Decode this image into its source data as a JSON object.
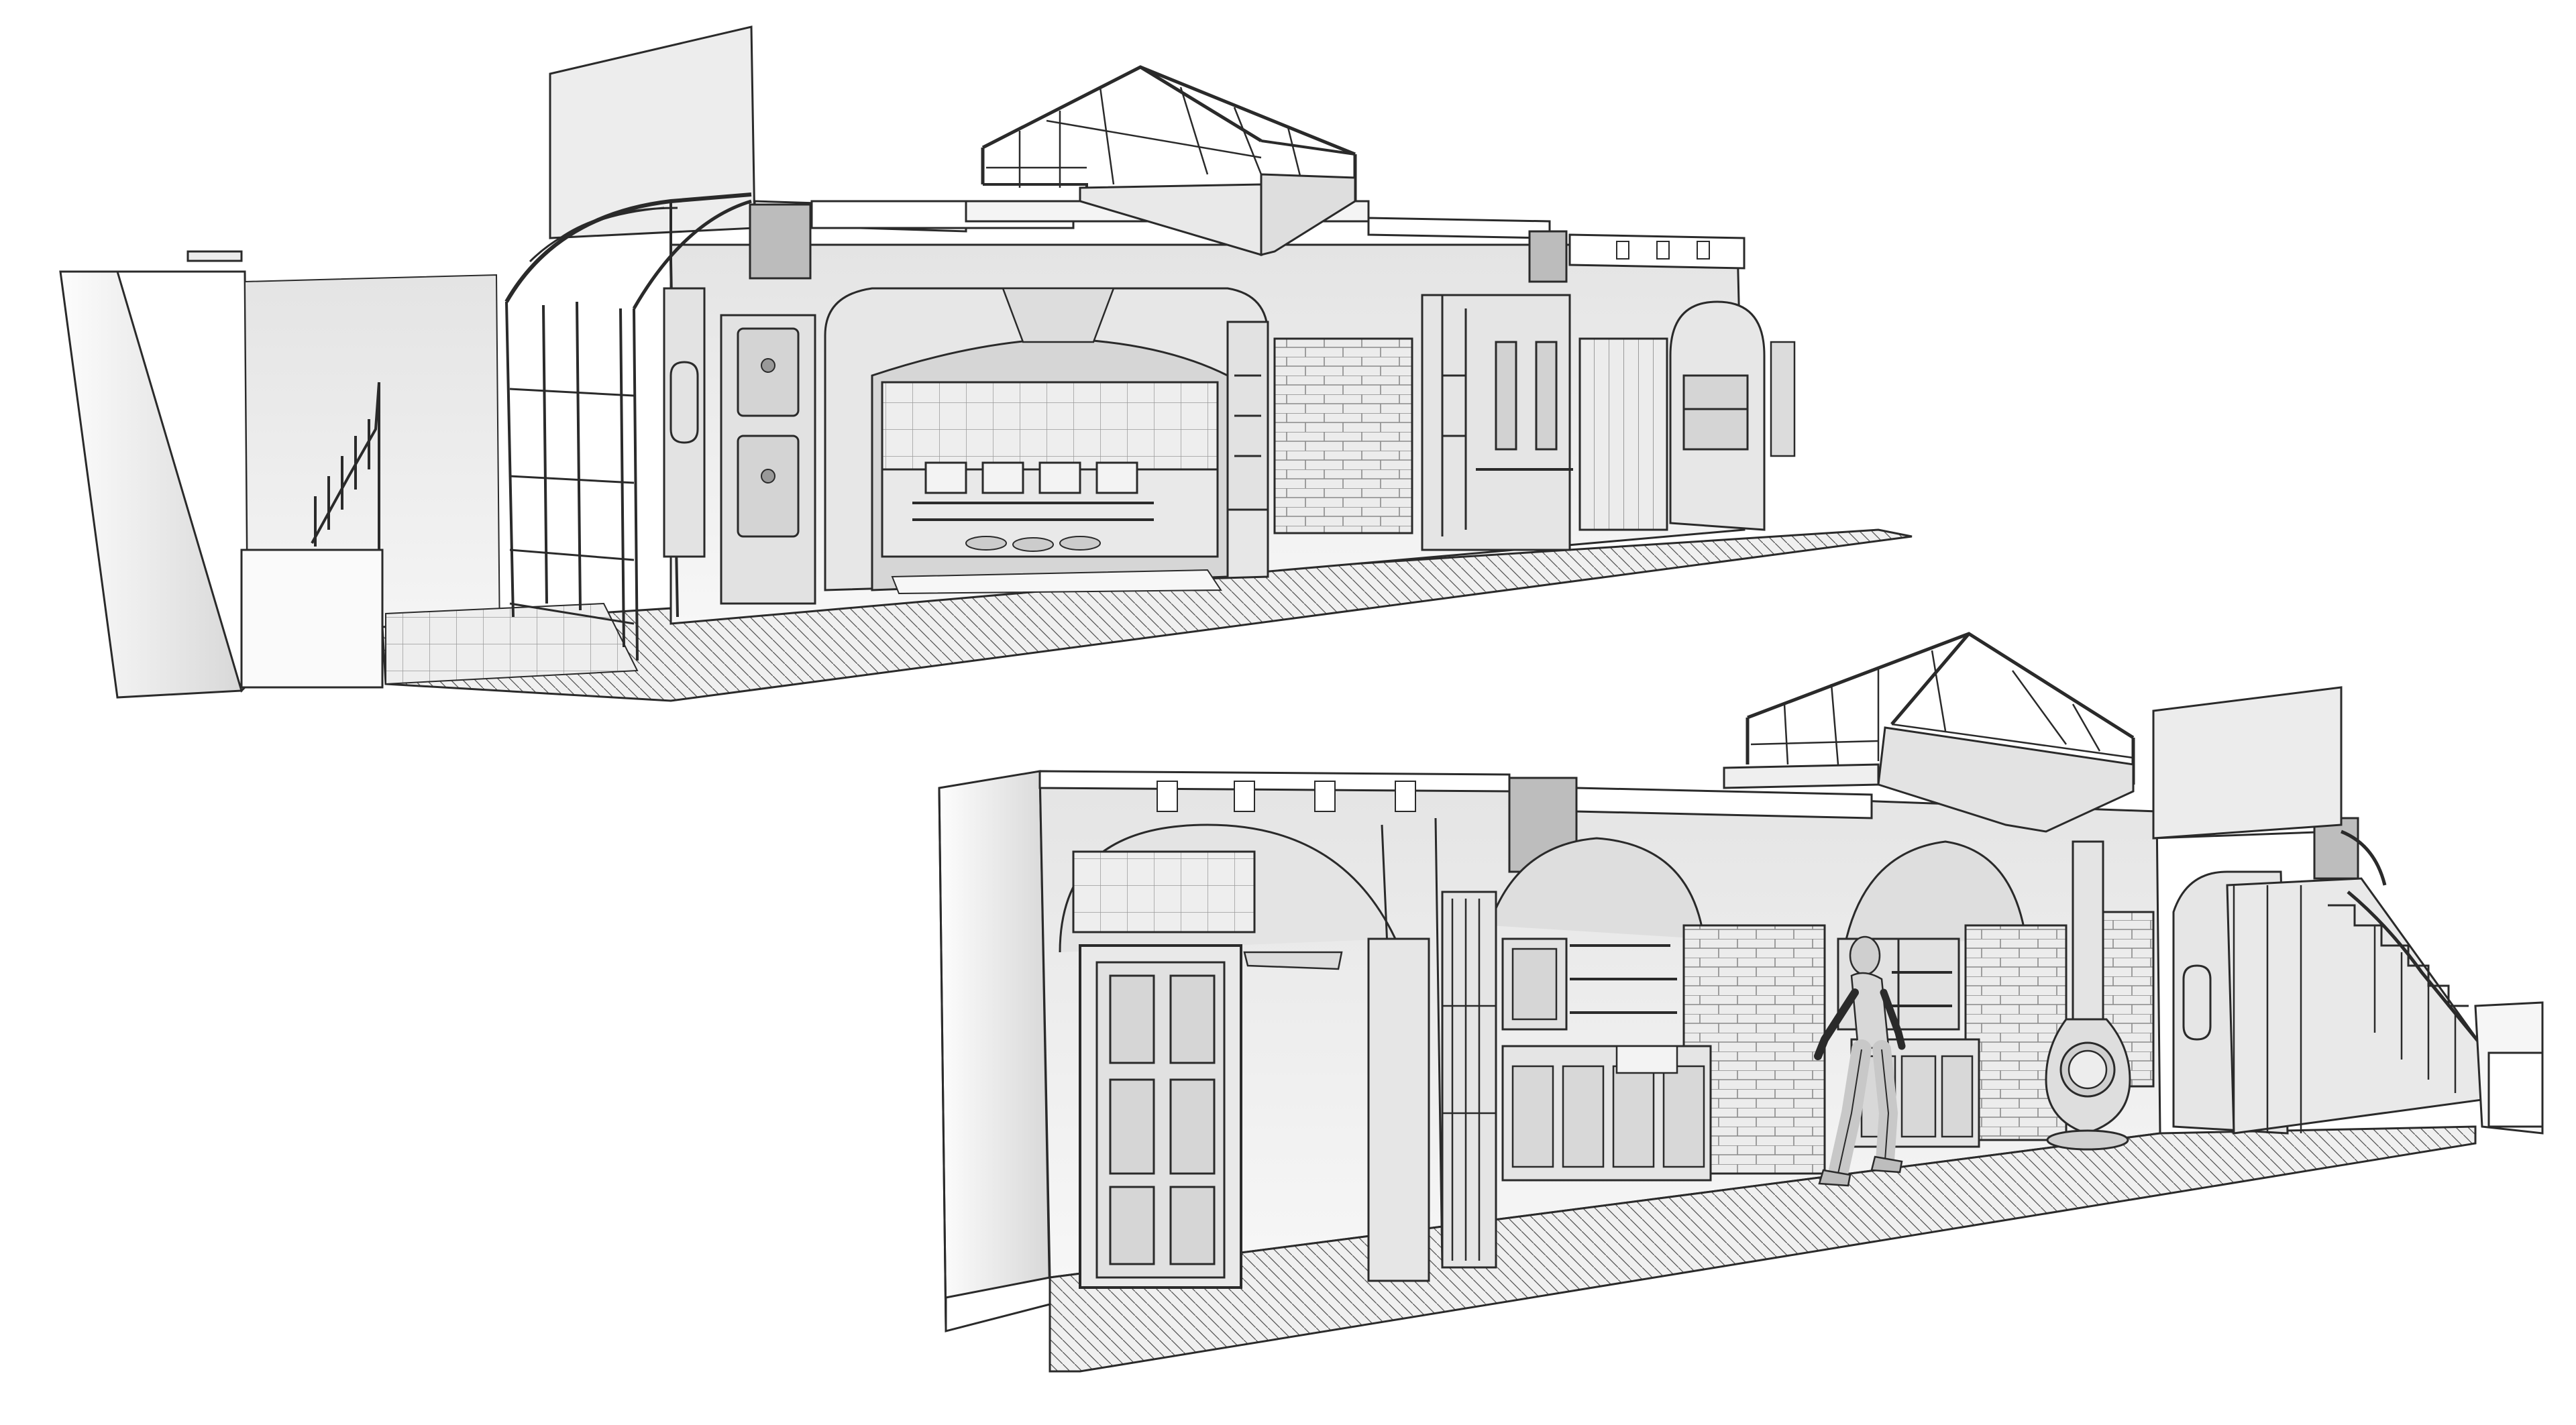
{
  "views": [
    {
      "id": "upper-view",
      "elements": [
        "street-wall",
        "stair-railing",
        "curved-conservatory",
        "main-wall",
        "range-hood-arch",
        "oven-doors",
        "tiled-alcove",
        "cooking-range",
        "glazed-doors",
        "brick-wall",
        "arched-dresser",
        "skylight-lantern",
        "floor-grid"
      ]
    },
    {
      "id": "lower-view",
      "elements": [
        "end-wall",
        "paneled-door",
        "vaulted-arches",
        "glazed-screen",
        "wall-cabinets",
        "open-shelves",
        "base-cabinets",
        "brick-splashback",
        "walking-figure",
        "column",
        "stove",
        "staircase",
        "skylight-lantern",
        "floor-grid"
      ]
    }
  ],
  "colors": {
    "background": "#ffffff",
    "line": "#2a2a2a",
    "wall_light": "#f2f2f2",
    "wall_mid": "#dcdcdc",
    "wall_shadow": "#c4c4c4",
    "floor": "#e6e6e6"
  }
}
